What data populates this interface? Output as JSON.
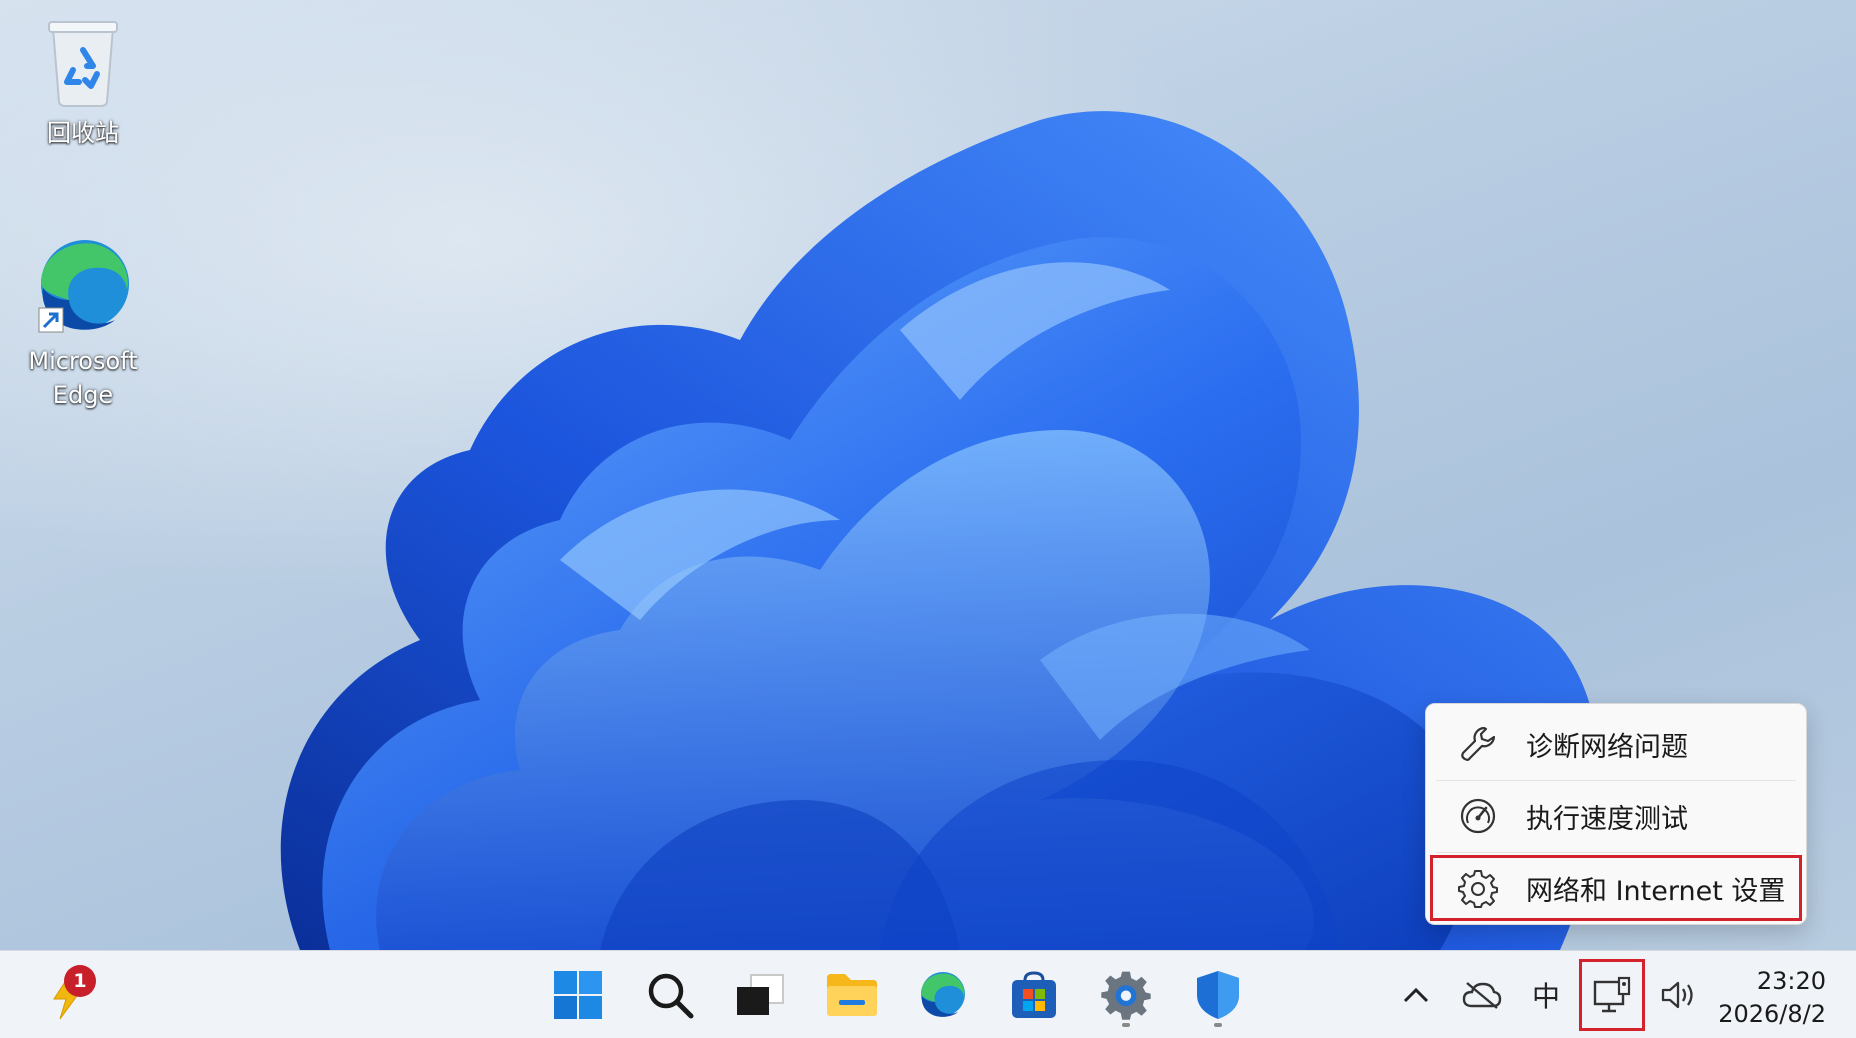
{
  "desktop": {
    "icons": [
      {
        "label": "回收站"
      },
      {
        "label": "Microsoft\nEdge"
      }
    ]
  },
  "context_menu": {
    "items": [
      {
        "label": "诊断网络问题",
        "icon": "wrench-icon"
      },
      {
        "label": "执行速度测试",
        "icon": "speedometer-icon"
      },
      {
        "label": "网络和 Internet 设置",
        "icon": "gear-icon"
      }
    ]
  },
  "taskbar": {
    "widget_badge": "1",
    "apps": [
      "start-icon",
      "search-icon",
      "task-view-icon",
      "file-explorer-icon",
      "edge-icon",
      "store-icon",
      "settings-icon",
      "defender-icon"
    ],
    "tray": {
      "ime": "中",
      "time": "23:20",
      "date": "2026/8/2"
    }
  },
  "colors": {
    "accent_highlight": "#d3222c",
    "bloom_blue": "#1f5fe0"
  }
}
